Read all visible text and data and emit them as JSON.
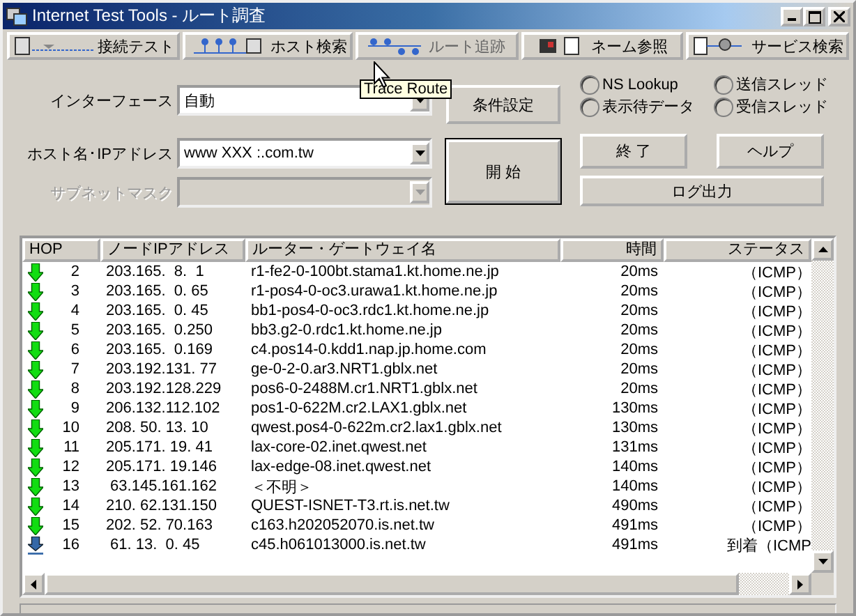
{
  "window": {
    "title": "Internet Test Tools - ルート調査"
  },
  "tabs": [
    {
      "label": "接続テスト",
      "selected": false
    },
    {
      "label": "ホスト検索",
      "selected": false
    },
    {
      "label": "ルート追跡",
      "selected": true
    },
    {
      "label": "ネーム参照",
      "selected": false
    },
    {
      "label": "サービス検索",
      "selected": false
    }
  ],
  "tooltip": "Trace Route",
  "fields": [
    {
      "label": "インターフェース",
      "value": "自動",
      "disabled": false
    },
    {
      "label": "ホスト名･IPアドレス",
      "value": "www XXX :.com.tw",
      "disabled": false
    },
    {
      "label": "サブネットマスク",
      "disabled": true
    }
  ],
  "buttons": {
    "settings": "条件設定",
    "start": "開 始",
    "quit": "終 了",
    "help": "ヘルプ",
    "log": "ログ出力"
  },
  "radios": [
    {
      "label": "NS Lookup",
      "checked": false
    },
    {
      "label": "送信スレッド",
      "checked": false
    },
    {
      "label": "表示待データ",
      "checked": false
    },
    {
      "label": "受信スレッド",
      "checked": false
    }
  ],
  "table": {
    "columns": [
      "HOP",
      "ノードIPアドレス",
      "ルーター・ゲートウェイ名",
      "時間",
      "ステータス"
    ],
    "rows": [
      {
        "kind": "hop",
        "hop": "2",
        "ip": "203.165.  8.  1",
        "name": "r1-fe2-0-100bt.stama1.kt.home.ne.jp",
        "time": "20ms",
        "status": "（ICMP）"
      },
      {
        "kind": "hop",
        "hop": "3",
        "ip": "203.165.  0. 65",
        "name": "r1-pos4-0-oc3.urawa1.kt.home.ne.jp",
        "time": "20ms",
        "status": "（ICMP）"
      },
      {
        "kind": "hop",
        "hop": "4",
        "ip": "203.165.  0. 45",
        "name": "bb1-pos4-0-oc3.rdc1.kt.home.ne.jp",
        "time": "20ms",
        "status": "（ICMP）"
      },
      {
        "kind": "hop",
        "hop": "5",
        "ip": "203.165.  0.250",
        "name": "bb3.g2-0.rdc1.kt.home.ne.jp",
        "time": "20ms",
        "status": "（ICMP）"
      },
      {
        "kind": "hop",
        "hop": "6",
        "ip": "203.165.  0.169",
        "name": "c4.pos14-0.kdd1.nap.jp.home.com",
        "time": "20ms",
        "status": "（ICMP）"
      },
      {
        "kind": "hop",
        "hop": "7",
        "ip": "203.192.131. 77",
        "name": "ge-0-2-0.ar3.NRT1.gblx.net",
        "time": "20ms",
        "status": "（ICMP）"
      },
      {
        "kind": "hop",
        "hop": "8",
        "ip": "203.192.128.229",
        "name": "pos6-0-2488M.cr1.NRT1.gblx.net",
        "time": "20ms",
        "status": "（ICMP）"
      },
      {
        "kind": "hop",
        "hop": "9",
        "ip": "206.132.112.102",
        "name": "pos1-0-622M.cr2.LAX1.gblx.net",
        "time": "130ms",
        "status": "（ICMP）"
      },
      {
        "kind": "hop",
        "hop": "10",
        "ip": "208. 50. 13. 10",
        "name": "qwest.pos4-0-622m.cr2.lax1.gblx.net",
        "time": "130ms",
        "status": "（ICMP）"
      },
      {
        "kind": "hop",
        "hop": "11",
        "ip": "205.171. 19. 41",
        "name": "lax-core-02.inet.qwest.net",
        "time": "131ms",
        "status": "（ICMP）"
      },
      {
        "kind": "hop",
        "hop": "12",
        "ip": "205.171. 19.146",
        "name": "lax-edge-08.inet.qwest.net",
        "time": "140ms",
        "status": "（ICMP）"
      },
      {
        "kind": "hop",
        "hop": "13",
        "ip": " 63.145.161.162",
        "name": "＜不明＞",
        "time": "140ms",
        "status": "（ICMP）"
      },
      {
        "kind": "hop",
        "hop": "14",
        "ip": "210. 62.131.150",
        "name": "QUEST-ISNET-T3.rt.is.net.tw",
        "time": "490ms",
        "status": "（ICMP）"
      },
      {
        "kind": "hop",
        "hop": "15",
        "ip": "202. 52. 70.163",
        "name": "c163.h202052070.is.net.tw",
        "time": "491ms",
        "status": "（ICMP）"
      },
      {
        "kind": "arrived",
        "hop": "16",
        "ip": " 61. 13.  0. 45",
        "name": "c45.h061013000.is.net.tw",
        "time": "491ms",
        "status": "到着（ICMP"
      }
    ]
  }
}
